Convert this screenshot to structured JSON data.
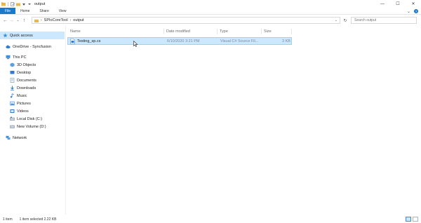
{
  "window": {
    "title": "output",
    "controls": {
      "minimize": "—",
      "maximize": "☐",
      "close": "✕"
    }
  },
  "ribbon": {
    "tabs": [
      "File",
      "Home",
      "Share",
      "View"
    ],
    "expand": "⌄",
    "help": "?"
  },
  "address": {
    "back": "←",
    "forward": "→",
    "recent": "⌄",
    "up": "↑",
    "path": [
      "SPIoCoreTool",
      "output"
    ],
    "refresh": "↻",
    "search_placeholder": "Search output"
  },
  "nav": {
    "items": [
      {
        "label": "Quick access",
        "icon": "star-icon",
        "selected": true
      },
      {
        "label": "OneDrive - Syncfusion",
        "icon": "cloud-icon"
      },
      {
        "label": "This PC",
        "icon": "computer-icon"
      },
      {
        "label": "3D Objects",
        "icon": "cube-icon"
      },
      {
        "label": "Desktop",
        "icon": "desktop-icon"
      },
      {
        "label": "Documents",
        "icon": "document-icon"
      },
      {
        "label": "Downloads",
        "icon": "download-icon"
      },
      {
        "label": "Music",
        "icon": "music-icon"
      },
      {
        "label": "Pictures",
        "icon": "picture-icon"
      },
      {
        "label": "Videos",
        "icon": "video-icon"
      },
      {
        "label": "Local Disk (C:)",
        "icon": "drive-icon"
      },
      {
        "label": "New Volume (D:)",
        "icon": "drive-icon"
      },
      {
        "label": "Network",
        "icon": "network-icon"
      }
    ]
  },
  "columns": {
    "name": "Name",
    "date": "Date modified",
    "type": "Type",
    "size": "Size"
  },
  "files": [
    {
      "name": "Testing_sp.cs",
      "date": "6/10/2020 3:21 PM",
      "type": "Visual C# Source Fil...",
      "size": "3 KB"
    }
  ],
  "status": {
    "count": "1 item",
    "selected": "1 item selected  2.22 KB"
  },
  "colors": {
    "accent": "#1979ca",
    "selection": "#cce8ff",
    "selection_border": "#99d1ff"
  }
}
